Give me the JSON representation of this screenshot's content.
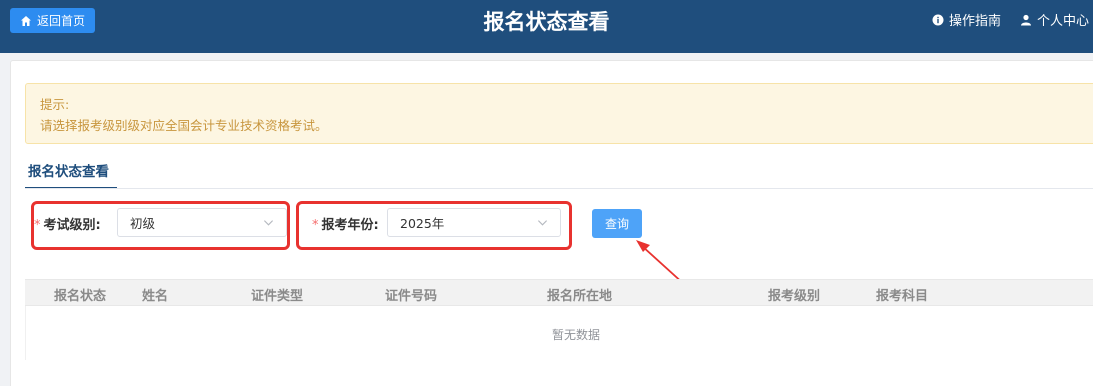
{
  "header": {
    "home_button": "返回首页",
    "title": "报名状态查看",
    "guide_link": "操作指南",
    "user_center_link": "个人中心"
  },
  "notice": {
    "title": "提示:",
    "body": "请选择报考级别级对应全国会计专业技术资格考试。"
  },
  "tabs": [
    {
      "label": "报名状态查看",
      "active": true
    }
  ],
  "form": {
    "level": {
      "label": "考试级别:",
      "required_mark": "*",
      "value": "初级"
    },
    "year": {
      "label": "报考年份:",
      "required_mark": "*",
      "value": "2025年"
    },
    "query_button": "查询"
  },
  "table": {
    "columns": [
      "报名状态",
      "姓名",
      "证件类型",
      "证件号码",
      "报名所在地",
      "报考级别",
      "报考科目"
    ],
    "rows": [],
    "empty_text": "暂无数据"
  },
  "colors": {
    "header_bg": "#1f4e7d",
    "primary_button": "#2d8cf0",
    "query_button": "#4ea3f8",
    "highlight": "#e8322f",
    "notice_bg": "#fdf6e2",
    "notice_text": "#c8963e"
  },
  "icons": {
    "home": "home-icon",
    "guide": "info-icon",
    "user": "user-icon",
    "select": "chevron-down-icon"
  }
}
